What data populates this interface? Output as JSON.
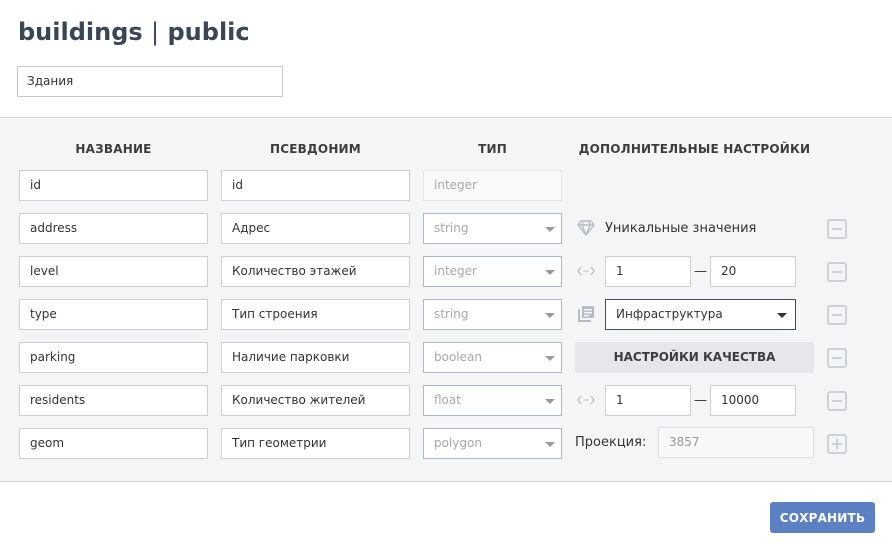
{
  "header": {
    "table_name": "buildings",
    "separator": "|",
    "schema": "public"
  },
  "layer_name_input": {
    "value": "Здания"
  },
  "columns": {
    "name": "НАЗВАНИЕ",
    "alias": "ПСЕВДОНИМ",
    "type": "ТИП",
    "extra": "ДОПОЛНИТЕЛЬНЫЕ НАСТРОЙКИ"
  },
  "rows": [
    {
      "name": "id",
      "alias": "id",
      "type": "integer",
      "type_editable": false
    },
    {
      "name": "address",
      "alias": "Адрес",
      "type": "string",
      "type_editable": true,
      "extra": {
        "kind": "unique",
        "icon": "diamond-icon",
        "label": "Уникальные значения"
      }
    },
    {
      "name": "level",
      "alias": "Количество этажей",
      "type": "integer",
      "type_editable": true,
      "extra": {
        "kind": "range",
        "icon": "range-icon",
        "min": "1",
        "max": "20",
        "dash": "—"
      }
    },
    {
      "name": "type",
      "alias": "Тип строения",
      "type": "string",
      "type_editable": true,
      "extra": {
        "kind": "dictionary",
        "icon": "dictionary-icon",
        "selected": "Инфраструктура"
      }
    },
    {
      "name": "parking",
      "alias": "Наличие парковки",
      "type": "boolean",
      "type_editable": true,
      "extra": {
        "kind": "button",
        "label": "НАСТРОЙКИ КАЧЕСТВА"
      }
    },
    {
      "name": "residents",
      "alias": "Количество жителей",
      "type": "float",
      "type_editable": true,
      "extra": {
        "kind": "range",
        "icon": "range-icon",
        "min": "1",
        "max": "10000",
        "dash": "—"
      }
    },
    {
      "name": "geom",
      "alias": "Тип геометрии",
      "type": "polygon",
      "type_editable": true,
      "extra": {
        "kind": "projection",
        "label": "Проекция:",
        "value": "3857"
      }
    }
  ],
  "row_actions": [
    "remove",
    "remove",
    "remove",
    "remove",
    "remove",
    "add"
  ],
  "footer": {
    "save_label": "СОХРАНИТЬ"
  },
  "colors": {
    "accent": "#5b80c3",
    "panel_bg": "#f4f5f7",
    "title": "#3a4556"
  }
}
